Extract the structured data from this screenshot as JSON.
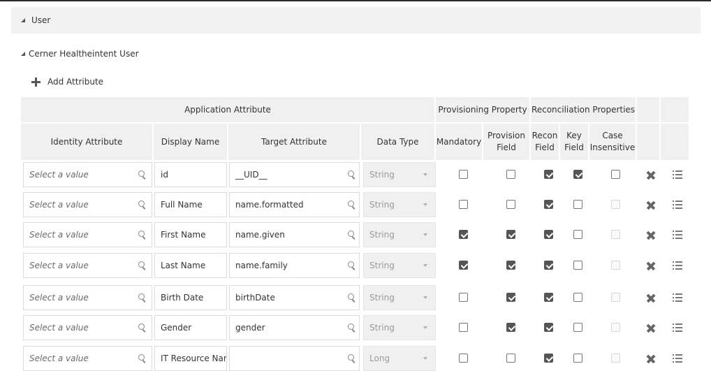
{
  "sections": {
    "user": "User",
    "subsection": "Cerner Healtheintent User"
  },
  "toolbar": {
    "add_attribute": "Add Attribute"
  },
  "groups": {
    "application_attribute": "Application Attribute",
    "provisioning_property": "Provisioning Property",
    "reconciliation_properties": "Reconciliation Properties"
  },
  "columns": {
    "identity_attribute": "Identity Attribute",
    "display_name": "Display Name",
    "target_attribute": "Target Attribute",
    "data_type": "Data Type",
    "mandatory": "Mandatory",
    "provision_field_1": "Provision",
    "provision_field_2": "Field",
    "recon_field_1": "Recon",
    "recon_field_2": "Field",
    "key_field_1": "Key",
    "key_field_2": "Field",
    "case_insensitive_1": "Case",
    "case_insensitive_2": "Insensitive"
  },
  "identity_placeholder": "Select a value",
  "rows": [
    {
      "display": "id",
      "target": "__UID__",
      "type": "String",
      "mandatory": false,
      "provision": false,
      "recon": true,
      "key": true,
      "case": false,
      "case_disabled": false
    },
    {
      "display": "Full Name",
      "target": "name.formatted",
      "type": "String",
      "mandatory": false,
      "provision": false,
      "recon": true,
      "key": false,
      "case": false,
      "case_disabled": true
    },
    {
      "display": "First Name",
      "target": "name.given",
      "type": "String",
      "mandatory": true,
      "provision": true,
      "recon": true,
      "key": false,
      "case": false,
      "case_disabled": true
    },
    {
      "display": "Last Name",
      "target": "name.family",
      "type": "String",
      "mandatory": true,
      "provision": true,
      "recon": true,
      "key": false,
      "case": false,
      "case_disabled": true
    },
    {
      "display": "Birth Date",
      "target": "birthDate",
      "type": "String",
      "mandatory": false,
      "provision": true,
      "recon": true,
      "key": false,
      "case": false,
      "case_disabled": true
    },
    {
      "display": "Gender",
      "target": "gender",
      "type": "String",
      "mandatory": false,
      "provision": true,
      "recon": true,
      "key": false,
      "case": false,
      "case_disabled": true
    },
    {
      "display": "IT Resource Nan",
      "target": "",
      "type": "Long",
      "mandatory": false,
      "provision": false,
      "recon": true,
      "key": false,
      "case": false,
      "case_disabled": true
    }
  ]
}
